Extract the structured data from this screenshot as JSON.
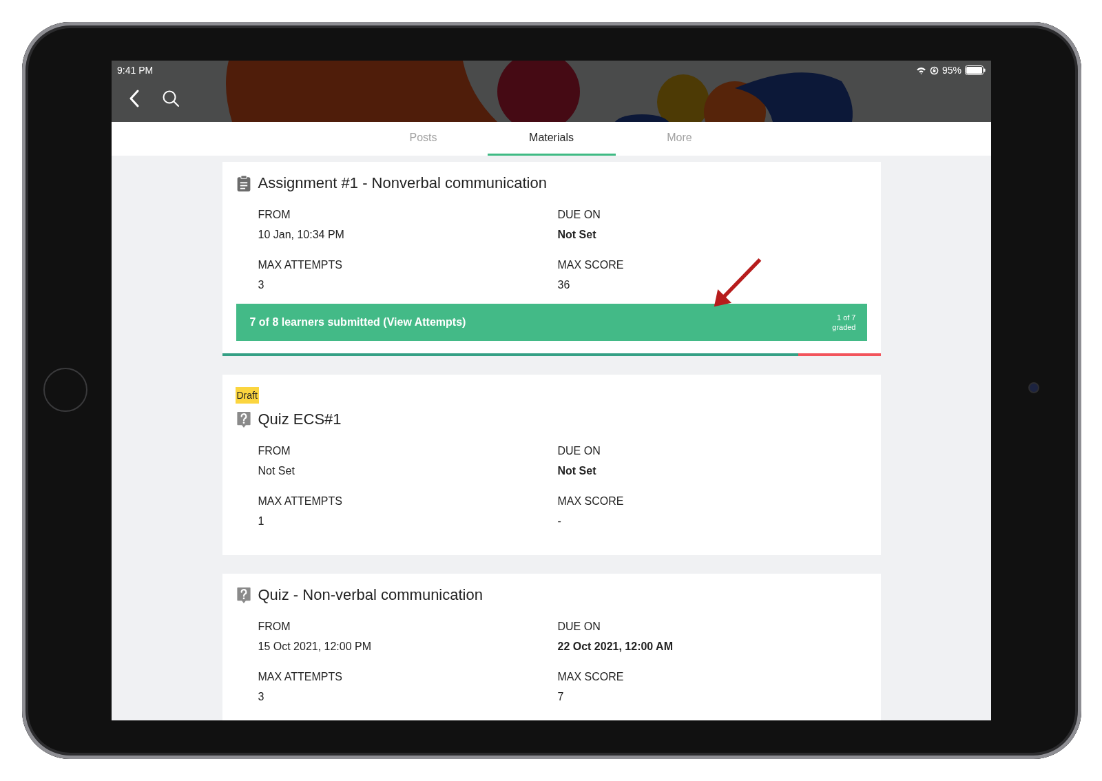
{
  "status_bar": {
    "time": "9:41 PM",
    "battery": "95%"
  },
  "tabs": [
    {
      "label": "Posts",
      "selected": false
    },
    {
      "label": "Materials",
      "selected": true
    },
    {
      "label": "More",
      "selected": false
    }
  ],
  "cards": [
    {
      "kind": "assignment",
      "title": "Assignment #1 - Nonverbal communication",
      "fields": [
        {
          "label": "FROM",
          "value": "10 Jan, 10:34 PM",
          "bold": false
        },
        {
          "label": "DUE ON",
          "value": "Not Set",
          "bold": true
        },
        {
          "label": "MAX ATTEMPTS",
          "value": "3",
          "bold": false
        },
        {
          "label": "MAX SCORE",
          "value": "36",
          "bold": false
        }
      ],
      "submissions": {
        "text": "7 of 8 learners submitted (View Attempts)",
        "graded": [
          "1 of 7",
          "graded"
        ]
      },
      "progress": {
        "level": 0.875
      }
    },
    {
      "kind": "quiz",
      "badge": "Draft",
      "title": "Quiz ECS#1",
      "fields": [
        {
          "label": "FROM",
          "value": "Not Set",
          "bold": false
        },
        {
          "label": "DUE ON",
          "value": "Not Set",
          "bold": true
        },
        {
          "label": "MAX ATTEMPTS",
          "value": "1",
          "bold": false
        },
        {
          "label": "MAX SCORE",
          "value": "-",
          "bold": false
        }
      ]
    },
    {
      "kind": "quiz",
      "title": "Quiz - Non-verbal communication",
      "fields": [
        {
          "label": "FROM",
          "value": "15 Oct 2021, 12:00 PM",
          "bold": false
        },
        {
          "label": "DUE ON",
          "value": "22 Oct 2021, 12:00 AM",
          "bold": true
        },
        {
          "label": "MAX ATTEMPTS",
          "value": "3",
          "bold": false
        },
        {
          "label": "MAX SCORE",
          "value": "7",
          "bold": false
        }
      ]
    }
  ]
}
